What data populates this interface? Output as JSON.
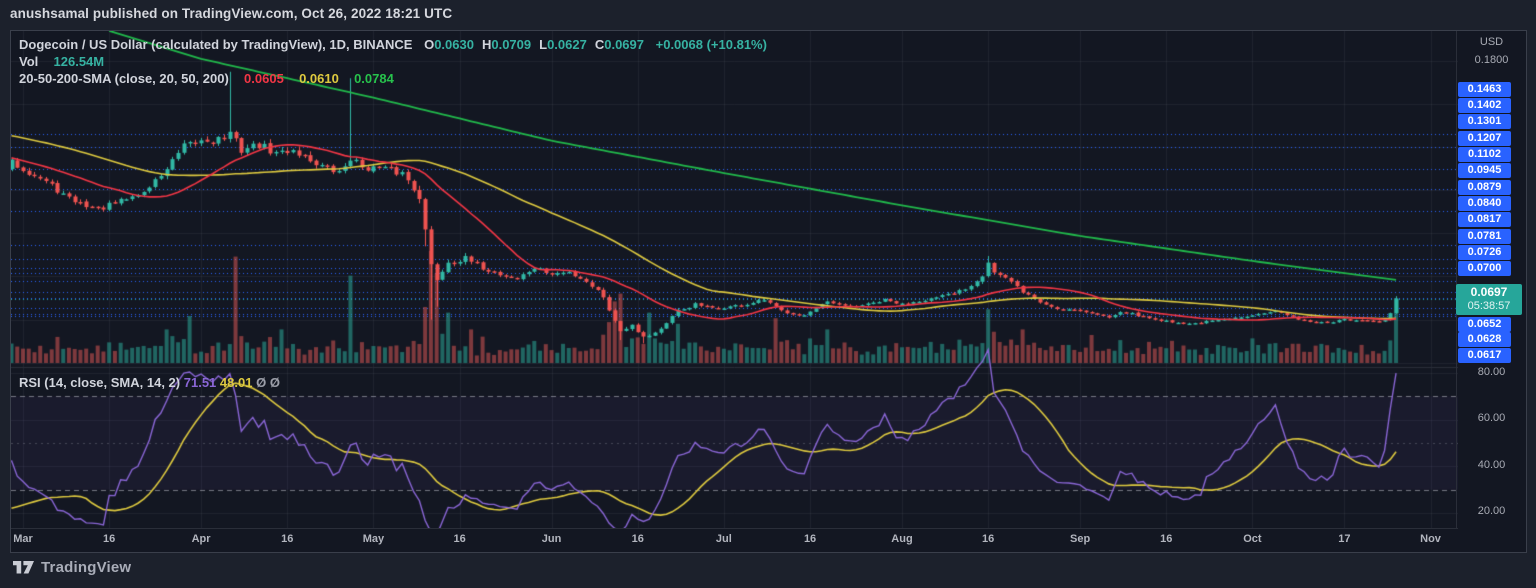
{
  "publish_header": "anushsamal published on TradingView.com, Oct 26, 2022 18:21 UTC",
  "symbol_legend": {
    "title": "Dogecoin / US Dollar (calculated by TradingView), 1D, BINANCE",
    "ohlc": [
      {
        "k": "O",
        "v": "0.0630"
      },
      {
        "k": "H",
        "v": "0.0709"
      },
      {
        "k": "L",
        "v": "0.0627"
      },
      {
        "k": "C",
        "v": "0.0697"
      }
    ],
    "change": "+0.0068 (+10.81%)",
    "vol_label": "Vol",
    "vol_value": "126.54M",
    "sma_label": "20-50-200-SMA (close, 20, 50, 200)",
    "sma20_value": "0.0605",
    "sma50_value": "0.0610",
    "sma200_value": "0.0784"
  },
  "rsi_legend": {
    "label": "RSI (14, close, SMA, 14, 2)",
    "rsi_value": "71.51",
    "sma_value": "48.01",
    "upper_band": "Ø",
    "lower_band": "Ø"
  },
  "price_axis": {
    "currency": "USD",
    "grid_label": "0.1800",
    "levels_above": [
      "0.1463",
      "0.1402",
      "0.1301",
      "0.1207",
      "0.1102",
      "0.0945",
      "0.0879",
      "0.0840",
      "0.0817",
      "0.0781",
      "0.0726",
      "0.0700"
    ],
    "last_price": "0.0697",
    "countdown": "05:38:57",
    "levels_below": [
      "0.0652",
      "0.0628",
      "0.0617"
    ],
    "rsi_ticks": [
      "80.00",
      "60.00",
      "40.00",
      "20.00"
    ]
  },
  "time_axis": [
    {
      "label": "Mar",
      "day": 0
    },
    {
      "label": "16",
      "day": 15
    },
    {
      "label": "Apr",
      "day": 31
    },
    {
      "label": "16",
      "day": 46
    },
    {
      "label": "May",
      "day": 61
    },
    {
      "label": "16",
      "day": 76
    },
    {
      "label": "Jun",
      "day": 92
    },
    {
      "label": "16",
      "day": 107
    },
    {
      "label": "Jul",
      "day": 122
    },
    {
      "label": "16",
      "day": 137
    },
    {
      "label": "Aug",
      "day": 153
    },
    {
      "label": "16",
      "day": 168
    },
    {
      "label": "Sep",
      "day": 184
    },
    {
      "label": "16",
      "day": 199
    },
    {
      "label": "Oct",
      "day": 214
    },
    {
      "label": "17",
      "day": 230
    },
    {
      "label": "Nov",
      "day": 245
    }
  ],
  "footer": {
    "brand": "TradingView"
  },
  "colors": {
    "page_bg": "#1c212c",
    "chart_bg": "#131722",
    "grid": "rgba(140,148,165,0.10)",
    "up": "#31b8a5",
    "down": "#ef5350",
    "vol_up": "rgba(44,167,152,0.55)",
    "vol_down": "rgba(233,92,88,0.50)",
    "sma20": "#f23645",
    "sma50": "#ddc93f",
    "sma200": "#21b84b",
    "rsi": "#8a66d6",
    "rsi_sma": "#ddc93f",
    "level_blue": "#2962ff",
    "last_teal": "#26a69a",
    "band_fill": "rgba(126,87,194,0.07)",
    "band_line": "rgba(196,199,208,0.55)",
    "mid_line": "rgba(170,173,182,0.30)",
    "separator": "#2a2e39"
  },
  "chart_data": {
    "type": "candlestick",
    "symbol": "Dogecoin / US Dollar",
    "exchange": "BINANCE",
    "interval": "1D",
    "title": "Dogecoin / US Dollar (calculated by TradingView), 1D, BINANCE",
    "ylim": [
      0.038,
      0.194
    ],
    "grid_step": 0.02,
    "grid_top": 0.18,
    "last_candle": {
      "open": 0.063,
      "high": 0.0709,
      "low": 0.0627,
      "close": 0.0697,
      "change": 0.0068,
      "change_pct": 10.81
    },
    "volume_current": "126.54M",
    "indicators": {
      "sma20": 0.0605,
      "sma50": 0.061,
      "sma200": 0.0784,
      "rsi": 71.51,
      "rsi_sma": 48.01
    },
    "rsi_levels": [
      70,
      50,
      30
    ],
    "rsi_range": [
      20,
      80
    ],
    "price_levels": [
      0.1463,
      0.1402,
      0.1301,
      0.1207,
      0.1102,
      0.0945,
      0.0879,
      0.084,
      0.0817,
      0.0781,
      0.0726,
      0.07,
      0.0652,
      0.0628,
      0.0617
    ],
    "day0_date": "2022-03-01",
    "last_day": 239,
    "close_anchors": [
      [
        -60,
        0.152
      ],
      [
        -50,
        0.156
      ],
      [
        -40,
        0.15
      ],
      [
        -32,
        0.158
      ],
      [
        -24,
        0.146
      ],
      [
        -16,
        0.139
      ],
      [
        -8,
        0.131
      ],
      [
        -4,
        0.127
      ],
      [
        -2,
        0.133
      ],
      [
        0,
        0.13
      ],
      [
        4,
        0.124
      ],
      [
        8,
        0.116
      ],
      [
        13,
        0.111
      ],
      [
        17,
        0.115
      ],
      [
        21,
        0.119
      ],
      [
        25,
        0.13
      ],
      [
        28,
        0.14
      ],
      [
        31,
        0.143
      ],
      [
        34,
        0.144
      ],
      [
        36,
        0.146
      ],
      [
        38,
        0.139
      ],
      [
        41,
        0.141
      ],
      [
        44,
        0.137
      ],
      [
        47,
        0.139
      ],
      [
        50,
        0.134
      ],
      [
        53,
        0.13
      ],
      [
        55,
        0.128
      ],
      [
        57,
        0.135
      ],
      [
        59,
        0.131
      ],
      [
        62,
        0.13
      ],
      [
        66,
        0.128
      ],
      [
        69,
        0.118
      ],
      [
        70,
        0.101
      ],
      [
        71,
        0.085
      ],
      [
        72,
        0.079
      ],
      [
        74,
        0.087
      ],
      [
        77,
        0.088
      ],
      [
        80,
        0.084
      ],
      [
        83,
        0.081
      ],
      [
        86,
        0.079
      ],
      [
        89,
        0.084
      ],
      [
        92,
        0.081
      ],
      [
        95,
        0.082
      ],
      [
        98,
        0.078
      ],
      [
        101,
        0.071
      ],
      [
        103,
        0.059
      ],
      [
        104,
        0.055
      ],
      [
        106,
        0.058
      ],
      [
        108,
        0.052
      ],
      [
        110,
        0.054
      ],
      [
        112,
        0.058
      ],
      [
        114,
        0.064
      ],
      [
        117,
        0.067
      ],
      [
        120,
        0.065
      ],
      [
        123,
        0.066
      ],
      [
        126,
        0.067
      ],
      [
        129,
        0.069
      ],
      [
        132,
        0.064
      ],
      [
        136,
        0.062
      ],
      [
        140,
        0.068
      ],
      [
        143,
        0.066
      ],
      [
        147,
        0.067
      ],
      [
        150,
        0.069
      ],
      [
        153,
        0.067
      ],
      [
        156,
        0.069
      ],
      [
        159,
        0.07
      ],
      [
        162,
        0.072
      ],
      [
        165,
        0.076
      ],
      [
        167,
        0.081
      ],
      [
        168,
        0.087
      ],
      [
        169,
        0.082
      ],
      [
        171,
        0.079
      ],
      [
        174,
        0.073
      ],
      [
        177,
        0.068
      ],
      [
        180,
        0.065
      ],
      [
        183,
        0.065
      ],
      [
        186,
        0.063
      ],
      [
        189,
        0.061
      ],
      [
        191,
        0.064
      ],
      [
        194,
        0.062
      ],
      [
        197,
        0.06
      ],
      [
        200,
        0.059
      ],
      [
        203,
        0.058
      ],
      [
        206,
        0.059
      ],
      [
        209,
        0.06
      ],
      [
        212,
        0.061
      ],
      [
        215,
        0.063
      ],
      [
        218,
        0.064
      ],
      [
        221,
        0.061
      ],
      [
        224,
        0.059
      ],
      [
        227,
        0.0585
      ],
      [
        230,
        0.06
      ],
      [
        233,
        0.0595
      ],
      [
        236,
        0.059
      ],
      [
        238,
        0.063
      ],
      [
        239,
        0.0697
      ]
    ],
    "sma200_anchors": [
      [
        15,
        0.194
      ],
      [
        31,
        0.181
      ],
      [
        61,
        0.163
      ],
      [
        92,
        0.143
      ],
      [
        122,
        0.128
      ],
      [
        153,
        0.113
      ],
      [
        184,
        0.0988
      ],
      [
        214,
        0.0872
      ],
      [
        239,
        0.0784
      ]
    ],
    "volatility_anchors": [
      [
        -60,
        0.9
      ],
      [
        20,
        0.9
      ],
      [
        30,
        1.1
      ],
      [
        40,
        1.2
      ],
      [
        60,
        1.0
      ],
      [
        69,
        1.6
      ],
      [
        73,
        1.8
      ],
      [
        80,
        1.2
      ],
      [
        95,
        1.0
      ],
      [
        103,
        1.6
      ],
      [
        110,
        1.3
      ],
      [
        120,
        0.9
      ],
      [
        150,
        0.8
      ],
      [
        165,
        1.0
      ],
      [
        169,
        1.3
      ],
      [
        175,
        0.9
      ],
      [
        190,
        0.7
      ],
      [
        200,
        0.55
      ],
      [
        215,
        0.6
      ],
      [
        230,
        0.5
      ],
      [
        237,
        0.5
      ],
      [
        239,
        0.8
      ]
    ],
    "candle_overrides": {
      "36": {
        "h": 0.175
      },
      "57": {
        "h": 0.172
      },
      "70": {
        "l": 0.094
      },
      "71": {
        "l": 0.06
      },
      "72": {
        "l": 0.066
      },
      "104": {
        "l": 0.0505
      },
      "108": {
        "l": 0.049
      },
      "168": {
        "h": 0.0895
      },
      "236": {
        "c": 0.059
      },
      "237": {
        "c": 0.0598
      },
      "238": {
        "c": 0.063
      },
      "239": {
        "o": 0.063,
        "h": 0.0709,
        "l": 0.0627,
        "c": 0.0697
      }
    },
    "volume_spikes": {
      "25": 0.3,
      "29": 0.42,
      "37": 0.95,
      "45": 0.3,
      "57": 0.78,
      "70": 0.5,
      "71": 1.0,
      "72": 0.8,
      "74": 0.45,
      "78": 0.3,
      "103": 0.55,
      "104": 0.62,
      "109": 0.45,
      "114": 0.35,
      "131": 0.4,
      "140": 0.3,
      "168": 0.48,
      "174": 0.3,
      "186": 0.25,
      "214": 0.22,
      "239": 0.58
    }
  }
}
